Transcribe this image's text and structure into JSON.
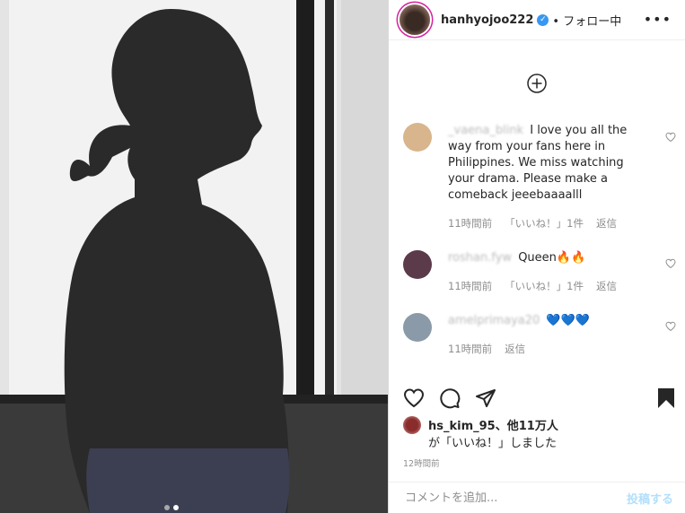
{
  "post": {
    "username": "hanhyojoo222",
    "follow_label": "• フォロー中",
    "more_label": "•••",
    "image_dots": 2,
    "active_dot": 1
  },
  "comments": [
    {
      "user": "_vaena_blink",
      "text": "I love you all the way from your fans here in Philippines. We miss watching your drama. Please make a comeback jeeebaaaalll",
      "time": "11時間前",
      "likes": "「いいね！」1件",
      "reply": "返信",
      "avatar_color": "#d8b58c"
    },
    {
      "user": "roshan.fyw",
      "text": "Queen🔥🔥",
      "time": "11時間前",
      "likes": "「いいね！」1件",
      "reply": "返信",
      "avatar_color": "#5b3a4a"
    },
    {
      "user": "amelprimaya20",
      "text": "💙💙💙",
      "time": "11時間前",
      "likes": "",
      "reply": "返信",
      "avatar_color": "#8a9aa8"
    }
  ],
  "liked_by": {
    "line1": "hs_kim_95、他11万人",
    "line2": "が「いいね！」しました"
  },
  "post_time": "12時間前",
  "add_comment": {
    "placeholder": "コメントを追加...",
    "post_label": "投稿する"
  },
  "colors": {
    "accent": "#0095f6",
    "post_button_disabled": "#b2dffc",
    "verified": "#3897f0",
    "story_ring": "#d6249f"
  }
}
